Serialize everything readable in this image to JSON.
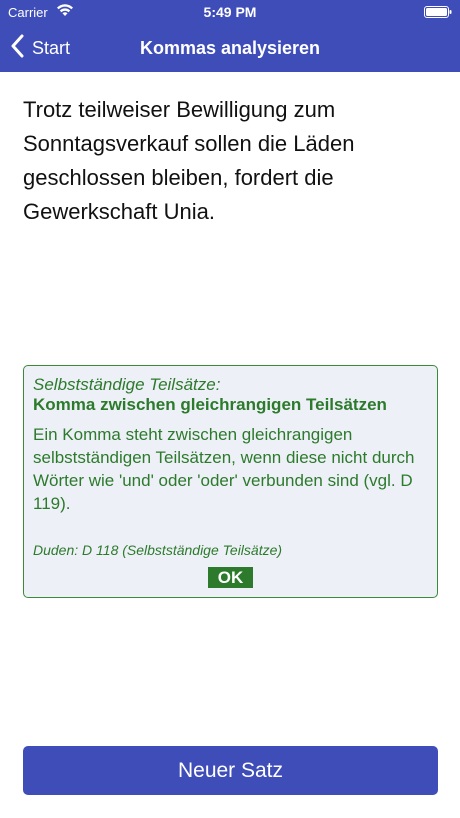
{
  "status_bar": {
    "carrier": "Carrier",
    "time": "5:49 PM",
    "wifi_icon": "wifi-icon",
    "battery_icon": "battery-icon"
  },
  "nav": {
    "back_label": "Start",
    "back_icon": "chevron-left-icon",
    "title": "Kommas analysieren"
  },
  "sentence": "Trotz teilweiser Bewilligung zum Sonntagsverkauf sollen die Läden geschlossen bleiben,  fordert die Gewerkschaft Unia.",
  "info": {
    "category": "Selbstständige Teilsätze:",
    "rule": "Komma zwischen gleichrangigen Teilsätzen",
    "explanation": "Ein Komma steht zwischen gleichrangigen selbstständigen Teilsätzen, wenn diese nicht durch Wörter wie 'und' oder 'oder' verbunden sind (vgl. D 119).",
    "source": "Duden: D 118 (Selbstständige Teilsätze)",
    "ok_label": "OK"
  },
  "footer": {
    "new_sentence_label": "Neuer Satz"
  },
  "colors": {
    "brand": "#3f4db8",
    "accent_green": "#2c7a2c",
    "info_background": "#eef0f7"
  }
}
